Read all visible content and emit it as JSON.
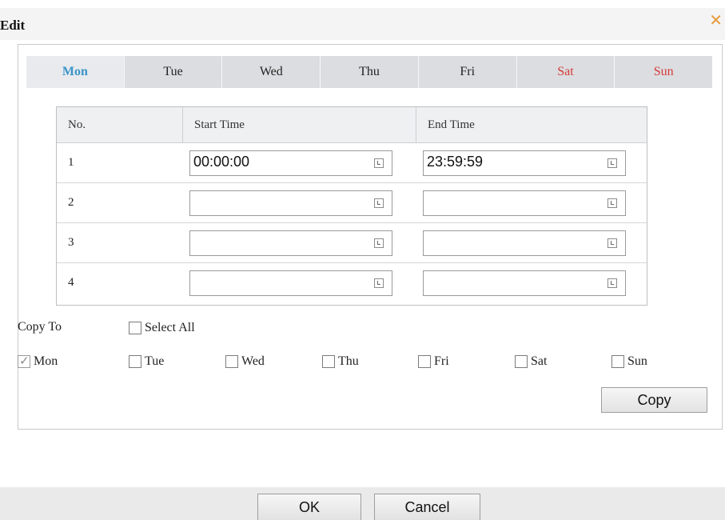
{
  "dialog": {
    "title": "Edit",
    "close_icon": "close-icon",
    "close_color": "#e79a3c"
  },
  "tabs": [
    {
      "label": "Mon",
      "active": true
    },
    {
      "label": "Tue"
    },
    {
      "label": "Wed"
    },
    {
      "label": "Thu"
    },
    {
      "label": "Fri"
    },
    {
      "label": "Sat",
      "weekend": true
    },
    {
      "label": "Sun",
      "weekend": true
    }
  ],
  "table": {
    "headers": [
      "No.",
      "Start Time",
      "End Time"
    ],
    "rows": [
      {
        "no": "1",
        "start": "00:00:00",
        "end": "23:59:59"
      },
      {
        "no": "2",
        "start": "",
        "end": ""
      },
      {
        "no": "3",
        "start": "",
        "end": ""
      },
      {
        "no": "4",
        "start": "",
        "end": ""
      }
    ]
  },
  "copy_to": {
    "label": "Copy To",
    "select_all": "Select All",
    "days": [
      {
        "label": "Mon",
        "checked": true
      },
      {
        "label": "Tue",
        "checked": false
      },
      {
        "label": "Wed",
        "checked": false
      },
      {
        "label": "Thu",
        "checked": false
      },
      {
        "label": "Fri",
        "checked": false
      },
      {
        "label": "Sat",
        "checked": false
      },
      {
        "label": "Sun",
        "checked": false
      }
    ],
    "copy_button": "Copy"
  },
  "footer": {
    "ok": "OK",
    "cancel": "Cancel"
  },
  "colors": {
    "active_tab": "#3a94c8",
    "weekend": "#d43a3a"
  }
}
